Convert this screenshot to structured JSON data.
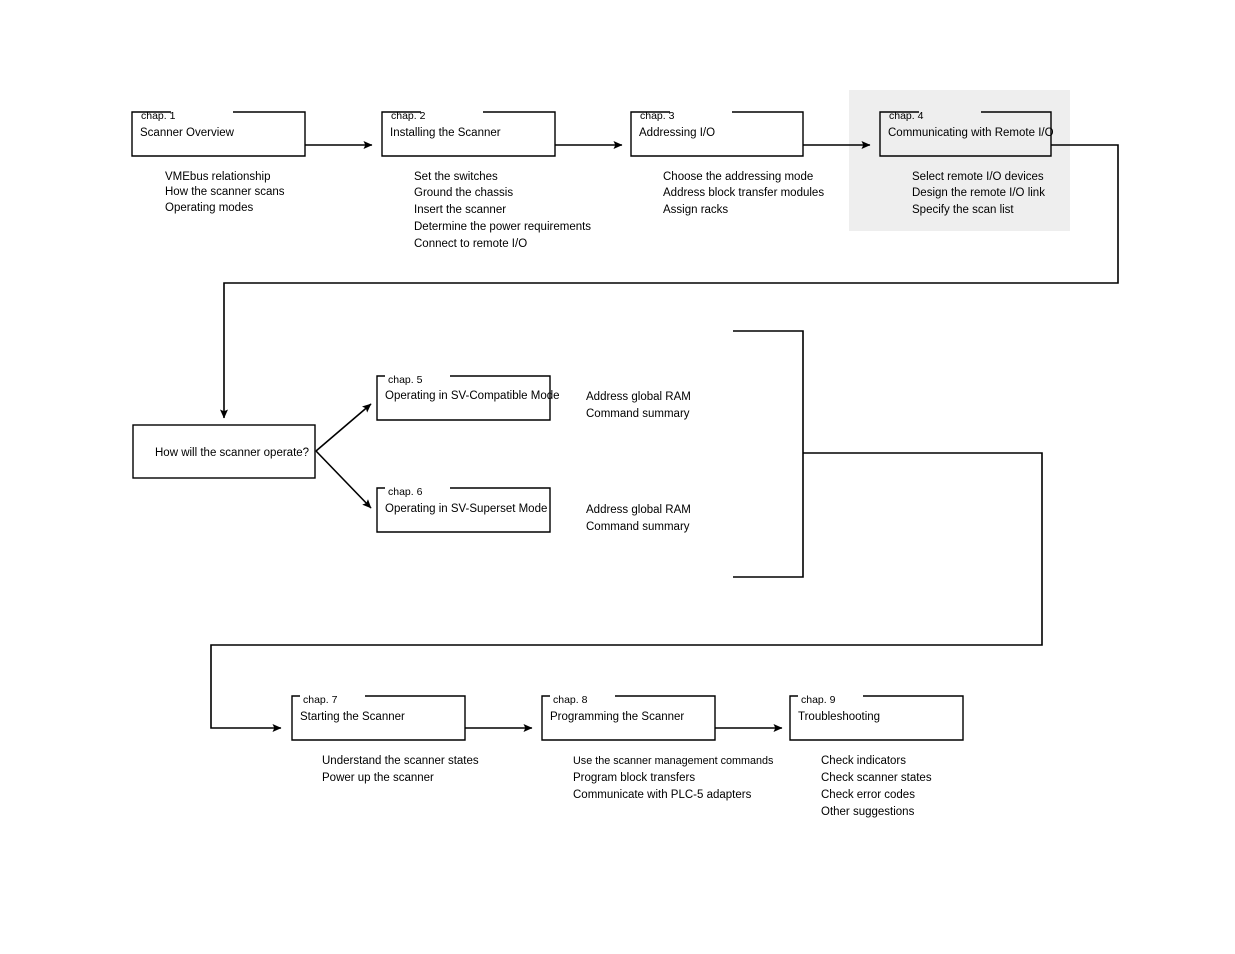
{
  "diagram": {
    "title": "Scanner manual chapter roadmap",
    "colors": {
      "line": "#000000",
      "highlight": "#eeeeee",
      "background": "#ffffff"
    },
    "decision": {
      "text": "How will the scanner operate?"
    },
    "chapters": [
      {
        "id": "chap1",
        "label": "chap. 1",
        "title": "Scanner Overview",
        "bullets": [
          "VMEbus relationship",
          "How the scanner scans",
          "Operating modes"
        ]
      },
      {
        "id": "chap2",
        "label": "chap. 2",
        "title": "Installing the Scanner",
        "bullets": [
          "Set the switches",
          "Ground the chassis",
          "Insert the scanner",
          "Determine the power requirements",
          "Connect to remote I/O"
        ]
      },
      {
        "id": "chap3",
        "label": "chap. 3",
        "title": "Addressing I/O",
        "bullets": [
          "Choose the addressing mode",
          "Address block transfer modules",
          "Assign racks"
        ]
      },
      {
        "id": "chap4",
        "label": "chap. 4",
        "title": "Communicating with Remote I/O",
        "bullets": [
          "Select remote I/O devices",
          "Design the remote I/O link",
          "Specify the scan list"
        ],
        "highlighted": true
      },
      {
        "id": "chap5",
        "label": "chap. 5",
        "title": "Operating in SV-Compatible Mode",
        "bullets": [
          "Address global RAM",
          "Command summary"
        ]
      },
      {
        "id": "chap6",
        "label": "chap. 6",
        "title": "Operating in SV-Superset Mode",
        "bullets": [
          "Address global RAM",
          "Command summary"
        ]
      },
      {
        "id": "chap7",
        "label": "chap. 7",
        "title": "Starting the Scanner",
        "bullets": [
          "Understand the scanner states",
          "Power up the scanner"
        ]
      },
      {
        "id": "chap8",
        "label": "chap. 8",
        "title": "Programming the Scanner",
        "bullets": [
          "Use the scanner management commands",
          "Program block transfers",
          "Communicate with PLC-5 adapters"
        ]
      },
      {
        "id": "chap9",
        "label": "chap. 9",
        "title": "Troubleshooting",
        "bullets": [
          "Check indicators",
          "Check scanner states",
          "Check error codes",
          "Other suggestions"
        ]
      }
    ]
  }
}
